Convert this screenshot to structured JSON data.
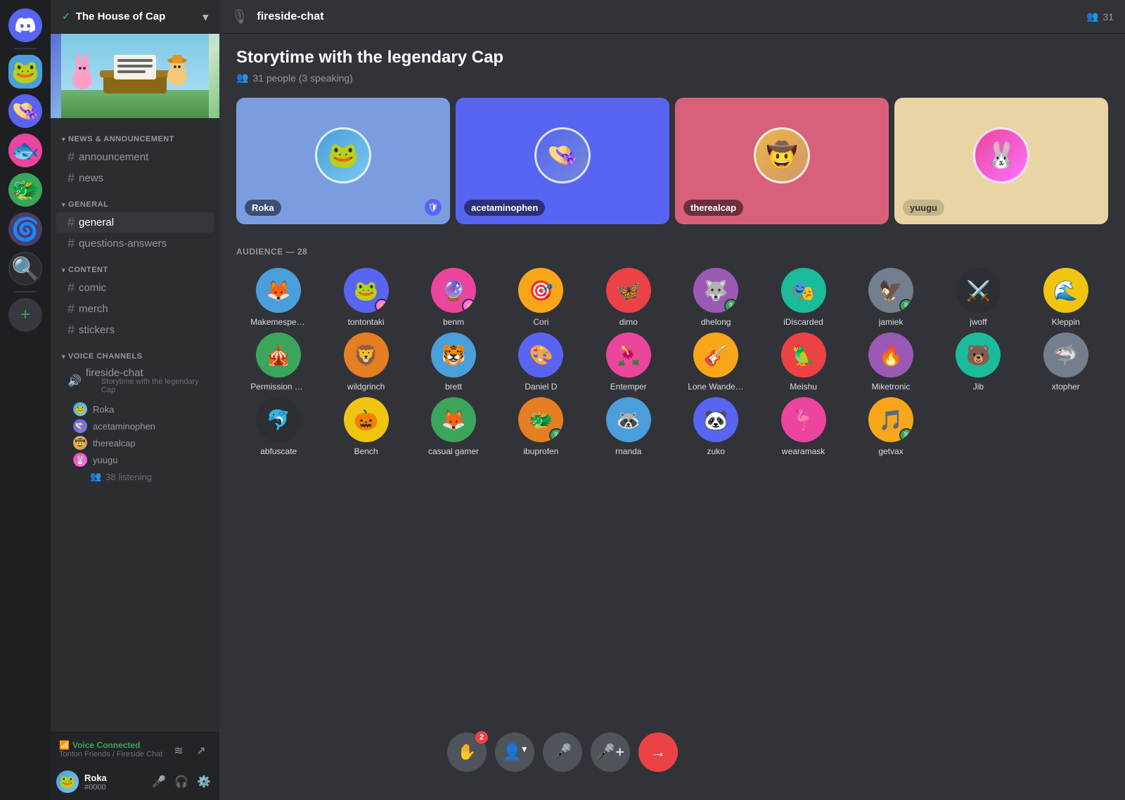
{
  "app": {
    "title": "DISCORD"
  },
  "server": {
    "name": "The House of Cap",
    "checkmark": "✓"
  },
  "channel_header": {
    "icon": "🎙",
    "name": "fireside-chat",
    "member_icon": "👥",
    "member_count": "31"
  },
  "stage": {
    "title": "Storytime with the legendary Cap",
    "people_icon": "👥",
    "people_count": "31 people (3 speaking)"
  },
  "speakers": [
    {
      "name": "Roka",
      "color": "blue-light",
      "has_mod": true
    },
    {
      "name": "acetaminophen",
      "color": "blue-mid",
      "has_mod": false
    },
    {
      "name": "therealcap",
      "color": "pink",
      "has_mod": false
    },
    {
      "name": "yuugu",
      "color": "tan",
      "has_mod": false
    }
  ],
  "audience_header": "AUDIENCE — 28",
  "audience": [
    {
      "name": "Makemespeakrr",
      "emoji": "🟡"
    },
    {
      "name": "tontontaki",
      "emoji": "🐸",
      "badge": "nitro"
    },
    {
      "name": "benm",
      "emoji": "🔵",
      "badge": "nitro"
    },
    {
      "name": "Cori",
      "emoji": "🟤"
    },
    {
      "name": "dimo",
      "emoji": "🔵"
    },
    {
      "name": "dhelong",
      "emoji": "⬜",
      "badge": "mic"
    },
    {
      "name": "iDiscarded",
      "emoji": "🟢"
    },
    {
      "name": "jamiek",
      "emoji": "🟫",
      "badge": "mic"
    },
    {
      "name": "jwoff",
      "emoji": "🟤"
    },
    {
      "name": "Kleppin",
      "emoji": "🟣"
    },
    {
      "name": "Permission Man",
      "emoji": "🔵"
    },
    {
      "name": "wildgrinch",
      "emoji": "🟤"
    },
    {
      "name": "brett",
      "emoji": "🔵"
    },
    {
      "name": "Daniel D",
      "emoji": "🟤"
    },
    {
      "name": "Entemper",
      "emoji": "🟣"
    },
    {
      "name": "Lone Wanderer",
      "emoji": "🩷"
    },
    {
      "name": "Meishu",
      "emoji": "🩷"
    },
    {
      "name": "Miketronic",
      "emoji": "🟤"
    },
    {
      "name": "Jib",
      "emoji": "🟡"
    },
    {
      "name": "xtopher",
      "emoji": "⬜"
    },
    {
      "name": "abfuscate",
      "emoji": "⚔️"
    },
    {
      "name": "Bench",
      "emoji": "🟦"
    },
    {
      "name": "casual gamer",
      "emoji": "🐱"
    },
    {
      "name": "ibuprofen",
      "emoji": "🔵",
      "badge": "mic"
    },
    {
      "name": "rnanda",
      "emoji": "🟤"
    },
    {
      "name": "zuko",
      "emoji": "🟤"
    },
    {
      "name": "wearamask",
      "emoji": "🔵"
    },
    {
      "name": "getvax",
      "emoji": "⬜",
      "badge": "mic"
    }
  ],
  "sidebar": {
    "categories": [
      {
        "name": "NEWS & ANNOUNCEMENT",
        "channels": [
          {
            "name": "announcement",
            "type": "text"
          },
          {
            "name": "news",
            "type": "text"
          }
        ]
      },
      {
        "name": "GENERAL",
        "channels": [
          {
            "name": "general",
            "type": "text",
            "active": true
          },
          {
            "name": "questions-answers",
            "type": "text"
          }
        ]
      },
      {
        "name": "CONTENT",
        "channels": [
          {
            "name": "comic",
            "type": "text"
          },
          {
            "name": "merch",
            "type": "text"
          },
          {
            "name": "stickers",
            "type": "text"
          }
        ]
      }
    ],
    "voice_channels": {
      "label": "VOICE CHANNELS",
      "channel": {
        "name": "fireside-chat",
        "subtitle": "Storytime with the legendary Cap",
        "members": [
          {
            "name": "Roka"
          },
          {
            "name": "acetaminophen"
          },
          {
            "name": "therealcap"
          },
          {
            "name": "yuugu"
          }
        ],
        "listening_count": "38 listening"
      }
    }
  },
  "voice_connected": {
    "status": "Voice Connected",
    "server": "Tonton Friends / Fireside Chat"
  },
  "user": {
    "name": "Roka",
    "tag": "#0000"
  },
  "toolbar": {
    "raise_hand_label": "✋",
    "raise_hand_badge": "2",
    "invite_label": "👤+",
    "mic_label": "🎤",
    "add_speaker_label": "🎤+",
    "leave_label": "→"
  }
}
